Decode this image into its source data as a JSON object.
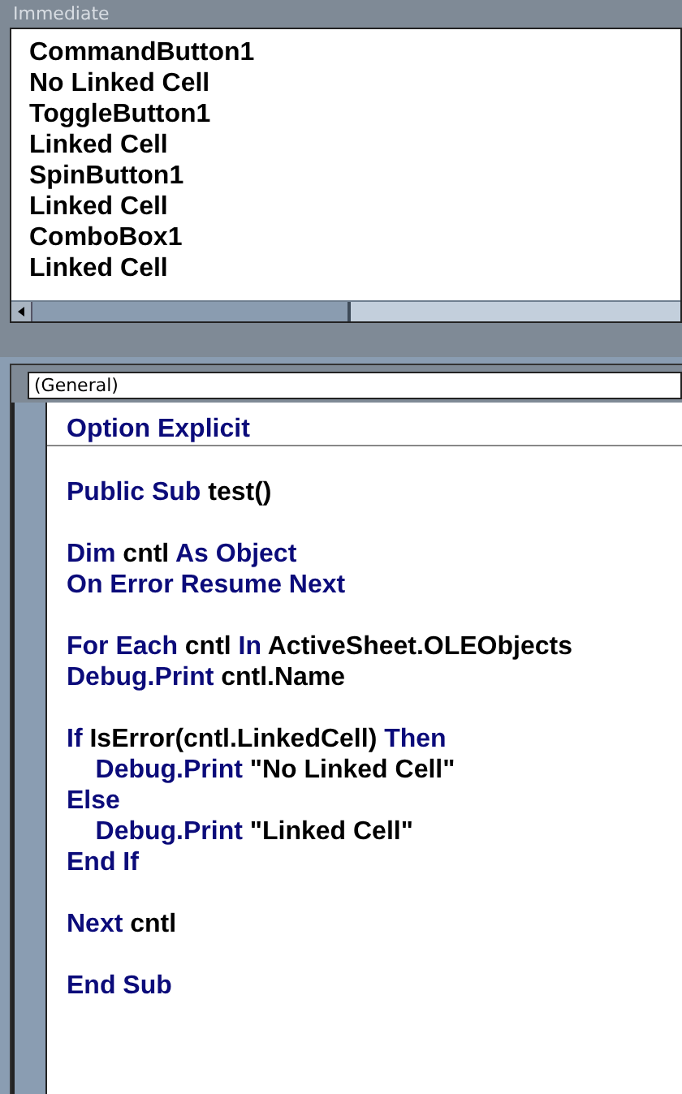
{
  "immediate": {
    "title": "Immediate",
    "lines": [
      "CommandButton1",
      "No Linked Cell",
      "ToggleButton1",
      "Linked Cell",
      "SpinButton1",
      "Linked Cell",
      "ComboBox1",
      "Linked Cell"
    ]
  },
  "code_window": {
    "object_box": "(General)",
    "blocks": [
      [
        [
          {
            "kind": "keyword",
            "text": "Option Explicit"
          }
        ]
      ],
      [
        [
          {
            "kind": "keyword",
            "text": "Public Sub "
          },
          {
            "kind": "plain",
            "text": "test()"
          }
        ]
      ],
      [
        [
          {
            "kind": "keyword",
            "text": "Dim "
          },
          {
            "kind": "plain",
            "text": "cntl "
          },
          {
            "kind": "keyword",
            "text": "As Object"
          }
        ],
        [
          {
            "kind": "keyword",
            "text": "On Error Resume Next"
          }
        ]
      ],
      [
        [
          {
            "kind": "keyword",
            "text": "For Each "
          },
          {
            "kind": "plain",
            "text": "cntl "
          },
          {
            "kind": "keyword",
            "text": "In "
          },
          {
            "kind": "plain",
            "text": "ActiveSheet.OLEObjects"
          }
        ],
        [
          {
            "kind": "keyword",
            "text": "Debug.Print "
          },
          {
            "kind": "plain",
            "text": "cntl.Name"
          }
        ]
      ],
      [
        [
          {
            "kind": "keyword",
            "text": "If "
          },
          {
            "kind": "plain",
            "text": "IsError(cntl.LinkedCell) "
          },
          {
            "kind": "keyword",
            "text": "Then"
          }
        ],
        [
          {
            "kind": "keyword",
            "text": "    Debug.Print "
          },
          {
            "kind": "plain",
            "text": "\"No Linked Cell\""
          }
        ],
        [
          {
            "kind": "keyword",
            "text": "Else"
          }
        ],
        [
          {
            "kind": "keyword",
            "text": "    Debug.Print "
          },
          {
            "kind": "plain",
            "text": "\"Linked Cell\""
          }
        ],
        [
          {
            "kind": "keyword",
            "text": "End If"
          }
        ]
      ],
      [
        [
          {
            "kind": "keyword",
            "text": "Next "
          },
          {
            "kind": "plain",
            "text": "cntl"
          }
        ]
      ],
      [
        [
          {
            "kind": "keyword",
            "text": "End Sub"
          }
        ]
      ]
    ]
  }
}
